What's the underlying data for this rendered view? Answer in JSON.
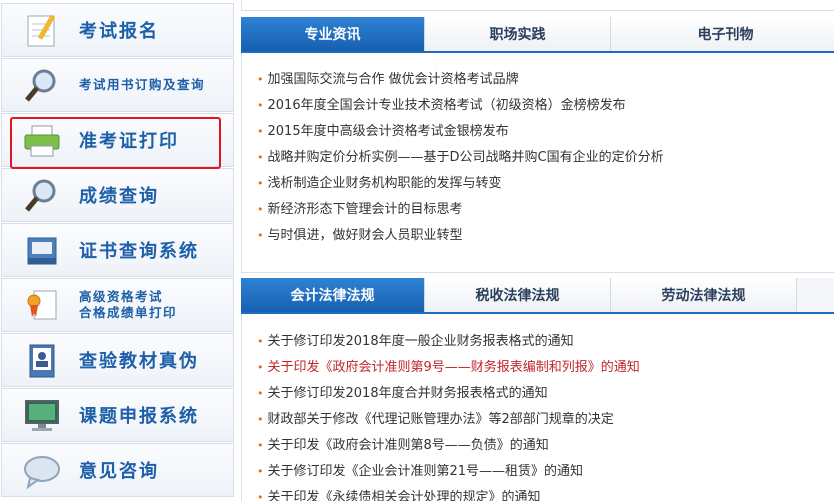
{
  "sidebar": {
    "items": [
      {
        "label": "考试报名",
        "icon": "notepad-icon"
      },
      {
        "label": "考试用书订购及查询",
        "icon": "magnifier-icon"
      },
      {
        "label": "准考证打印",
        "icon": "printer-icon"
      },
      {
        "label": "成绩查询",
        "icon": "magnifier-icon"
      },
      {
        "label": "证书查询系统",
        "icon": "certificate-box-icon"
      },
      {
        "label_line1": "高级资格考试",
        "label_line2": "合格成绩单打印",
        "icon": "award-document-icon"
      },
      {
        "label": "查验教材真伪",
        "icon": "id-card-icon"
      },
      {
        "label": "课题申报系统",
        "icon": "monitor-icon"
      },
      {
        "label": "意见咨询",
        "icon": "speech-bubble-icon"
      }
    ]
  },
  "panel1": {
    "tabs": [
      "专业资讯",
      "职场实践",
      "电子刊物"
    ],
    "items": [
      "加强国际交流与合作 做优会计资格考试品牌",
      "2016年度全国会计专业技术资格考试（初级资格）金榜榜发布",
      "2015年度中高级会计资格考试金银榜发布",
      "战略并购定价分析实例——基于D公司战略并购C国有企业的定价分析",
      "浅析制造企业财务机构职能的发挥与转变",
      "新经济形态下管理会计的目标思考",
      "与时俱进，做好财会人员职业转型"
    ]
  },
  "panel2": {
    "tabs": [
      "会计法律法规",
      "税收法律法规",
      "劳动法律法规"
    ],
    "items": [
      "关于修订印发2018年度一般企业财务报表格式的通知",
      "关于印发《政府会计准则第9号——财务报表编制和列报》的通知",
      "关于修订印发2018年度合并财务报表格式的通知",
      "财政部关于修改《代理记账管理办法》等2部部门规章的决定",
      "关于印发《政府会计准则第8号——负债》的通知",
      "关于修订印发《企业会计准则第21号——租赁》的通知",
      "关于印发《永续债相关会计处理的规定》的通知"
    ]
  },
  "colors": {
    "accent": "#1d5fa8",
    "highlight": "#e0151f",
    "bullet": "#e06a1b",
    "link_red": "#c0262a"
  }
}
